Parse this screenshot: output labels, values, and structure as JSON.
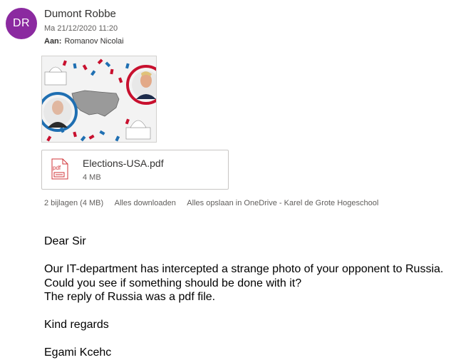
{
  "sender": {
    "initials": "DR",
    "name": "Dumont Robbe",
    "avatar_color": "#8b2aa0",
    "date": "Ma 21/12/2020 11:20",
    "to_label": "Aan:",
    "to_name": "Romanov Nicolai"
  },
  "attachment": {
    "file_name": "Elections-USA.pdf",
    "file_size": "4 MB",
    "icon_label": "pdf"
  },
  "attachments_bar": {
    "count": "2 bijlagen (4 MB)",
    "download_all": "Alles downloaden",
    "save_all": "Alles opslaan in OneDrive - Karel de Grote Hogeschool"
  },
  "message": {
    "greeting": "Dear Sir",
    "line1": "Our IT-department has intercepted a strange photo of your opponent to Russia.",
    "line2": "Could you see if something should be done with it?",
    "line3": "The reply of Russia was a pdf file.",
    "closing": "Kind regards",
    "signature": "Egami Kcehc"
  },
  "colors": {
    "accent_red": "#c8102e",
    "accent_blue": "#1f6fb2",
    "pdf_red": "#d13438"
  }
}
